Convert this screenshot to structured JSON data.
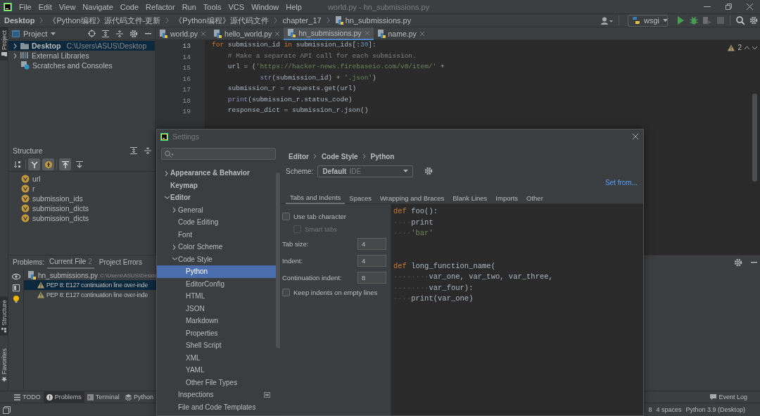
{
  "window": {
    "title": "world.py - hn_submissions.py"
  },
  "menu": [
    "File",
    "Edit",
    "View",
    "Navigate",
    "Code",
    "Refactor",
    "Run",
    "Tools",
    "VCS",
    "Window",
    "Help"
  ],
  "breadcrumb": [
    {
      "label": "Desktop",
      "kind": "root"
    },
    {
      "label": "《Python编程》源代码文件-更新",
      "kind": "folder"
    },
    {
      "label": "《Python编程》源代码文件",
      "kind": "folder"
    },
    {
      "label": "chapter_17",
      "kind": "folder"
    },
    {
      "label": "hn_submissions.py",
      "kind": "file"
    }
  ],
  "toolbar": {
    "run_config": "wsgi"
  },
  "side_tabs": [
    {
      "label": "Project",
      "selected": true
    },
    {
      "label": "Structure",
      "selected": true
    },
    {
      "label": "Favorites",
      "selected": false
    }
  ],
  "project_panel": {
    "title": "Project",
    "tree": [
      {
        "label": "Desktop",
        "path": "C:\\Users\\ASUS\\Desktop",
        "kind": "folder",
        "selected": true
      },
      {
        "label": "External Libraries",
        "kind": "library",
        "selected": false
      },
      {
        "label": "Scratches and Consoles",
        "kind": "scratch",
        "selected": false
      }
    ]
  },
  "structure_panel": {
    "title": "Structure",
    "toggles": [
      {
        "kind": "sort",
        "on": false
      },
      {
        "kind": "inherited",
        "on": true
      },
      {
        "kind": "fields",
        "on": true
      },
      {
        "kind": "scroll_to",
        "on": true
      },
      {
        "kind": "scroll_from",
        "on": false
      }
    ],
    "items": [
      "url",
      "r",
      "submission_ids",
      "submission_dicts",
      "submission_dicts"
    ]
  },
  "editor_tabs": [
    {
      "label": "world.py",
      "selected": false
    },
    {
      "label": "hello_world.py",
      "selected": false
    },
    {
      "label": "hn_submissions.py",
      "selected": true
    },
    {
      "label": "name.py",
      "selected": false
    }
  ],
  "editor": {
    "lines": [
      {
        "number": "13",
        "tokens": [
          {
            "text": "for",
            "kind": "kw"
          },
          {
            "text": " submission_id ",
            "kind": "p"
          },
          {
            "text": "in",
            "kind": "kw"
          },
          {
            "text": " submission_ids[:",
            "kind": "p"
          },
          {
            "text": "30",
            "kind": "num"
          },
          {
            "text": "]:",
            "kind": "p"
          }
        ]
      },
      {
        "number": "14",
        "tokens": [
          {
            "text": "    # Make a separate API call for each submission.",
            "kind": "cm"
          }
        ]
      },
      {
        "number": "15",
        "tokens": [
          {
            "text": "    url = (",
            "kind": "p"
          },
          {
            "text": "'https://hacker-news.firebaseio.com/v0/item/'",
            "kind": "str"
          },
          {
            "text": " +",
            "kind": "p"
          }
        ]
      },
      {
        "number": "16",
        "tokens": [
          {
            "text": "            str",
            "kind": "bi"
          },
          {
            "text": "(submission_id) + ",
            "kind": "p"
          },
          {
            "text": "'.json'",
            "kind": "str"
          },
          {
            "text": ")",
            "kind": "p"
          }
        ]
      },
      {
        "number": "17",
        "tokens": [
          {
            "text": "    submission_r = requests.get(url)",
            "kind": "p"
          }
        ]
      },
      {
        "number": "18",
        "tokens": [
          {
            "text": "    print",
            "kind": "bi"
          },
          {
            "text": "(submission_r.status_code)",
            "kind": "p"
          }
        ]
      },
      {
        "number": "19",
        "tokens": [
          {
            "text": "    response_dict = submission_r.json()",
            "kind": "p"
          }
        ]
      }
    ],
    "warnings": "2"
  },
  "problems_panel": {
    "title": "Problems:",
    "tabs": [
      {
        "label": "Current File",
        "count": "2",
        "selected": true
      },
      {
        "label": "Project Errors",
        "selected": false
      }
    ],
    "file": {
      "name": "hn_submissions.py",
      "path": "C:\\Users\\ASUS\\Deskto"
    },
    "items": [
      {
        "text": "PEP 8: E127 continuation line over-inde",
        "selected": true
      },
      {
        "text": "PEP 8: E127 continuation line over-inde",
        "selected": false
      }
    ]
  },
  "tool_tabs": [
    {
      "label": "TODO",
      "kind": "todo",
      "selected": false
    },
    {
      "label": "Problems",
      "kind": "problems",
      "selected": true
    },
    {
      "label": "Terminal",
      "kind": "terminal",
      "selected": false
    },
    {
      "label": "Python",
      "kind": "python",
      "selected": false
    }
  ],
  "event_log": "Event Log",
  "status_bar": [
    "8",
    "4 spaces",
    "Python 3.9 (Desktop)"
  ],
  "settings": {
    "title": "Settings",
    "tree": [
      {
        "label": "Appearance & Behavior",
        "expanded": false,
        "selected": false
      },
      {
        "label": "Keymap",
        "selected": false
      },
      {
        "label": "Editor",
        "expanded": true,
        "selected": false,
        "children": [
          {
            "label": "General",
            "expanded": false,
            "selected": false
          },
          {
            "label": "Code Editing",
            "selected": false
          },
          {
            "label": "Font",
            "selected": false
          },
          {
            "label": "Color Scheme",
            "expanded": false,
            "selected": false
          },
          {
            "label": "Code Style",
            "expanded": true,
            "selected": false,
            "children": [
              {
                "label": "Python",
                "selected": true
              },
              {
                "label": "EditorConfig",
                "selected": false
              },
              {
                "label": "HTML",
                "selected": false
              },
              {
                "label": "JSON",
                "selected": false
              },
              {
                "label": "Markdown",
                "selected": false
              },
              {
                "label": "Properties",
                "selected": false
              },
              {
                "label": "Shell Script",
                "selected": false
              },
              {
                "label": "XML",
                "selected": false
              },
              {
                "label": "YAML",
                "selected": false
              },
              {
                "label": "Other File Types",
                "selected": false
              }
            ]
          },
          {
            "label": "Inspections",
            "selected": false,
            "scoped": true
          },
          {
            "label": "File and Code Templates",
            "selected": false
          }
        ]
      }
    ],
    "breadcrumb": [
      "Editor",
      "Code Style",
      "Python"
    ],
    "set_from": "Set from...",
    "scheme": {
      "label": "Scheme:",
      "value": "Default",
      "note": "IDE"
    },
    "tabs": [
      {
        "label": "Tabs and Indents",
        "selected": true
      },
      {
        "label": "Spaces",
        "selected": false
      },
      {
        "label": "Wrapping and Braces",
        "selected": false
      },
      {
        "label": "Blank Lines",
        "selected": false
      },
      {
        "label": "Imports",
        "selected": false
      },
      {
        "label": "Other",
        "selected": false
      }
    ],
    "options": [
      {
        "kind": "checkbox",
        "label": "Use tab character",
        "checked": false,
        "disabled": false
      },
      {
        "kind": "subcheckbox",
        "label": "Smart tabs",
        "checked": false,
        "disabled": true
      },
      {
        "kind": "number",
        "label": "Tab size:",
        "value": "4"
      },
      {
        "kind": "number",
        "label": "Indent:",
        "value": "4"
      },
      {
        "kind": "number",
        "label": "Continuation indent:",
        "value": "8"
      },
      {
        "kind": "checkbox",
        "label": "Keep indents on empty lines",
        "checked": false,
        "disabled": false
      }
    ],
    "preview": [
      [
        [
          {
            "text": "def",
            "kind": "kw"
          },
          {
            "text": " foo():",
            "kind": "p"
          }
        ],
        [
          {
            "text": "····",
            "kind": "ws"
          },
          {
            "text": "print",
            "kind": "p"
          }
        ],
        [
          {
            "text": "····",
            "kind": "ws"
          },
          {
            "text": "'bar'",
            "kind": "str"
          }
        ]
      ],
      [
        [
          {
            "text": "def",
            "kind": "kw"
          },
          {
            "text": " long_function_name(",
            "kind": "p"
          }
        ],
        [
          {
            "text": "········",
            "kind": "ws"
          },
          {
            "text": "var_one, var_two, var_three,",
            "kind": "p"
          }
        ],
        [
          {
            "text": "········",
            "kind": "ws"
          },
          {
            "text": "var_four):",
            "kind": "p"
          }
        ],
        [
          {
            "text": "····",
            "kind": "ws"
          },
          {
            "text": "print(var_one)",
            "kind": "p"
          }
        ]
      ]
    ]
  }
}
